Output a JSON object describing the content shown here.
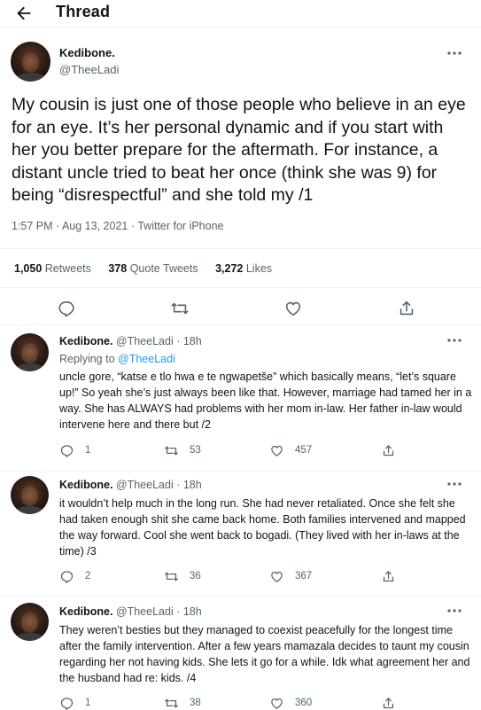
{
  "header": {
    "title": "Thread",
    "back_icon": "arrow-left-icon"
  },
  "main_tweet": {
    "name": "Kedibone.",
    "handle": "@TheeLadi",
    "text": "My cousin is just one of those people who believe in an eye for an eye. It’s her personal dynamic and if you start with her you better prepare for the aftermath. For instance, a distant uncle tried to beat her once (think she was 9) for being “disrespectful” and she told my /1",
    "meta": "1:57 PM · Aug 13, 2021 · Twitter for iPhone",
    "retweets_count": "1,050",
    "retweets_label": "Retweets",
    "quotes_count": "378",
    "quotes_label": "Quote Tweets",
    "likes_count": "3,272",
    "likes_label": "Likes"
  },
  "replies": [
    {
      "name": "Kedibone.",
      "handle_time": "@TheeLadi · 18h",
      "replying_prefix": "Replying to",
      "replying_to": "@TheeLadi",
      "text": "uncle gore, “katse e tlo hwa e te ngwapetše” which basically means, “let’s square up!” So yeah she’s just always been like that. However, marriage had tamed her in a way. She has ALWAYS had problems with her mom in-law. Her father in-law would intervene here and there but /2",
      "replies_count": "1",
      "retweets_count": "53",
      "likes_count": "457"
    },
    {
      "name": "Kedibone.",
      "handle_time": "@TheeLadi · 18h",
      "text": "it wouldn’t help much in the long run. She had never retaliated. Once she felt she had taken enough shit she came back home. Both families intervened and mapped the way forward. Cool she went back to bogadi. (They lived with her in-laws at the time) /3",
      "replies_count": "2",
      "retweets_count": "36",
      "likes_count": "367"
    },
    {
      "name": "Kedibone.",
      "handle_time": "@TheeLadi · 18h",
      "text": "They weren’t besties but they managed to coexist peacefully for the longest time after the family intervention. After a few years mamazala decides to taunt my cousin regarding her not having kids. She lets it go for a while. Idk what agreement her and the husband had re: kids. /4",
      "replies_count": "1",
      "retweets_count": "38",
      "likes_count": "360"
    }
  ],
  "colors": {
    "text": "#0f1419",
    "secondary": "#536471",
    "link": "#1d9bf0",
    "divider": "#eff3f4"
  }
}
